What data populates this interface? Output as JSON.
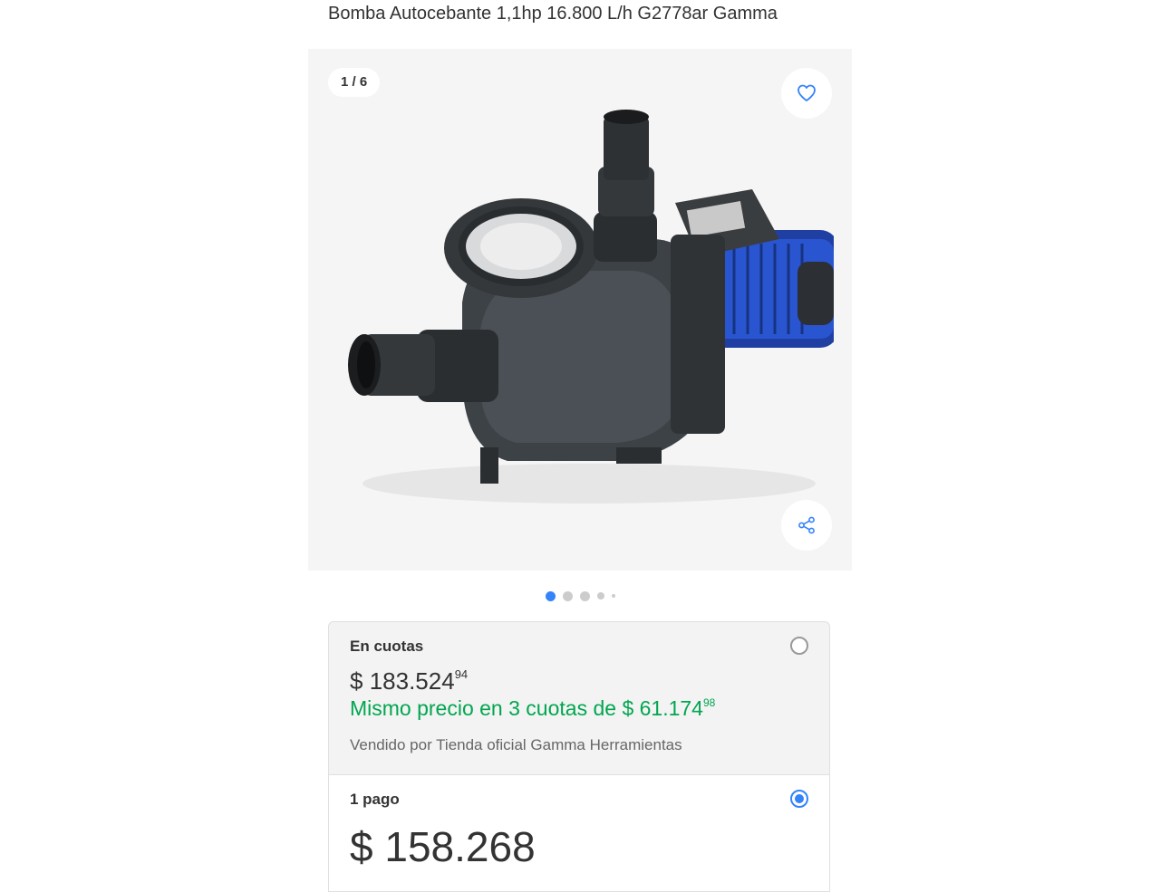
{
  "product": {
    "title": "Bomba Autocebante 1,1hp 16.800 L/h G2778ar Gamma"
  },
  "gallery": {
    "counter": "1 / 6",
    "fav_icon": "heart-icon",
    "share_icon": "share-icon",
    "dots_total": 5,
    "active_dot": 0
  },
  "payment_options": {
    "installments": {
      "label": "En cuotas",
      "price_currency": "$",
      "price_main": "183.524",
      "price_cents": "94",
      "installment_text": "Mismo precio en 3 cuotas de",
      "installment_currency": "$",
      "installment_main": "61.174",
      "installment_cents": "98",
      "seller": "Vendido por Tienda oficial Gamma Herramientas",
      "selected": false
    },
    "single": {
      "label": "1 pago",
      "price_currency": "$",
      "price_main": "158.268",
      "selected": true
    }
  },
  "colors": {
    "accent": "#3483fa",
    "green": "#00a650"
  }
}
